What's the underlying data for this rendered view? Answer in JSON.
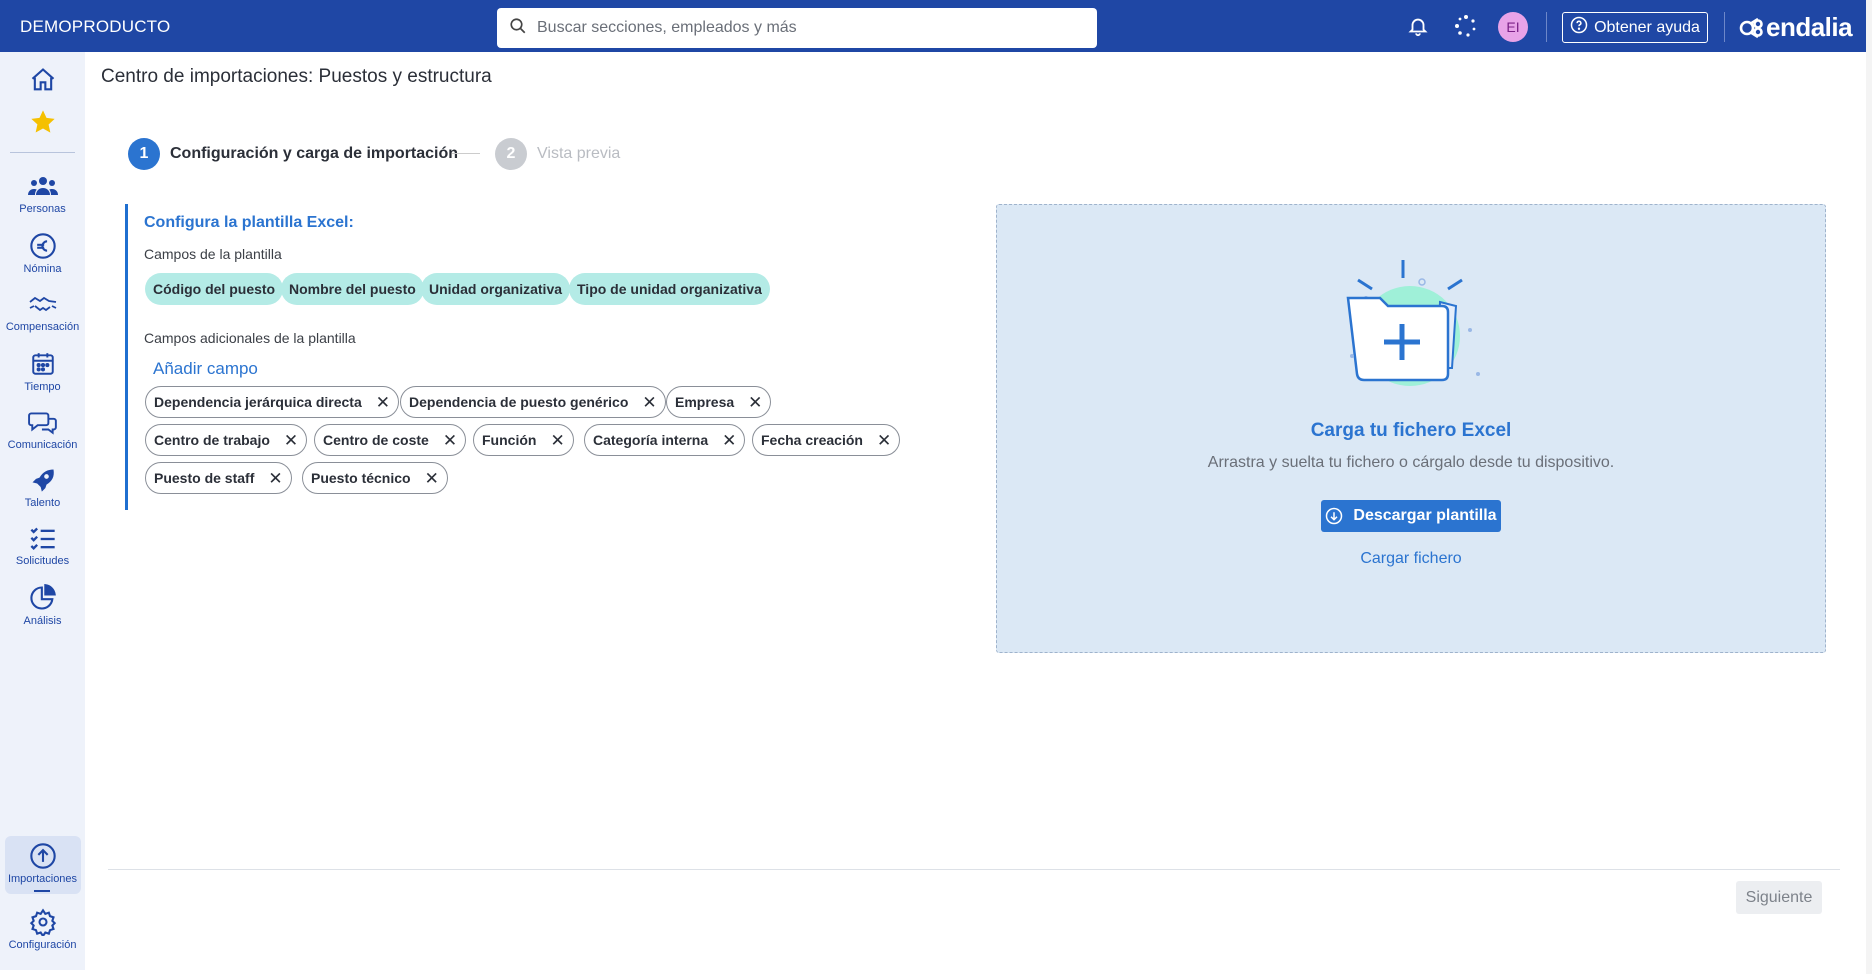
{
  "topbar": {
    "company": "DEMOPRODUCTO",
    "search_placeholder": "Buscar secciones, empleados y más",
    "avatar_initials": "EI",
    "help_label": "Obtener ayuda",
    "logo_text": "endalia",
    "colors": {
      "bar": "#1f47a5"
    }
  },
  "sidebar": {
    "items": [
      {
        "label": "",
        "icon": "home-icon"
      },
      {
        "label": "",
        "icon": "star-icon"
      },
      {
        "label": "Personas",
        "icon": "people-icon"
      },
      {
        "label": "Nómina",
        "icon": "euro-icon"
      },
      {
        "label": "Compensación",
        "icon": "handshake-icon"
      },
      {
        "label": "Tiempo",
        "icon": "calendar-icon"
      },
      {
        "label": "Comunicación",
        "icon": "chat-icon"
      },
      {
        "label": "Talento",
        "icon": "rocket-icon"
      },
      {
        "label": "Solicitudes",
        "icon": "checklist-icon"
      },
      {
        "label": "Análisis",
        "icon": "pie-chart-icon"
      },
      {
        "label": "Importaciones",
        "icon": "upload-icon"
      },
      {
        "label": "Configuración",
        "icon": "gear-icon"
      }
    ],
    "active": "Importaciones"
  },
  "page": {
    "title": "Centro de importaciones: Puestos y estructura",
    "steps": [
      {
        "number": "1",
        "label": "Configuración y carga de importación",
        "state": "active"
      },
      {
        "number": "2",
        "label": "Vista previa",
        "state": "inactive"
      }
    ]
  },
  "config": {
    "title": "Configura la plantilla Excel:",
    "fixed_label": "Campos de la plantilla",
    "fixed_fields": [
      "Código del puesto",
      "Nombre del puesto",
      "Unidad organizativa",
      "Tipo de unidad organizativa"
    ],
    "additional_label": "Campos adicionales de la plantilla",
    "add_field": "Añadir campo",
    "additional_fields": [
      "Dependencia jerárquica directa",
      "Dependencia de puesto genérico",
      "Empresa",
      "Centro de trabajo",
      "Centro de coste",
      "Función",
      "Categoría interna",
      "Fecha creación",
      "Puesto de staff",
      "Puesto técnico"
    ]
  },
  "upload": {
    "title": "Carga tu fichero Excel",
    "subtitle": "Arrastra y suelta tu fichero o cárgalo desde tu dispositivo.",
    "download_label": "Descargar plantilla",
    "upload_label": "Cargar fichero"
  },
  "footer": {
    "next_label": "Siguiente"
  }
}
